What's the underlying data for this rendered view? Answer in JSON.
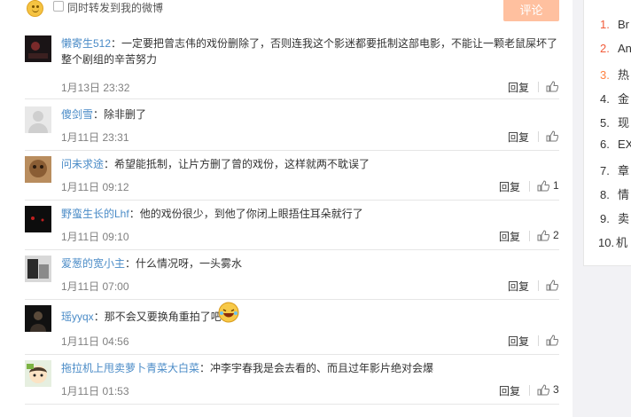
{
  "compose": {
    "repost_label": "同时转发到我的微博",
    "submit_label": "评论"
  },
  "comments": [
    {
      "user": "懒寄生512",
      "text": "一定要把曾志伟的戏份删除了，否则连我这个影迷都要抵制这部电影，不能让一颗老鼠屎坏了整个剧组的辛苦努力",
      "time": "1月13日 23:32",
      "reply": "回复",
      "likes": ""
    },
    {
      "user": "傻剑雪",
      "text": "除非删了",
      "time": "1月11日 23:31",
      "reply": "回复",
      "likes": ""
    },
    {
      "user": "问未求途",
      "text": "希望能抵制，让片方删了曾的戏份，这样就两不耽误了",
      "time": "1月11日 09:12",
      "reply": "回复",
      "likes": "1"
    },
    {
      "user": "野蛮生长的Lhf",
      "text": "他的戏份很少，到他了你闭上眼捂住耳朵就行了",
      "time": "1月11日 09:10",
      "reply": "回复",
      "likes": "2"
    },
    {
      "user": "爱葱的宽小主",
      "text": "什么情况呀，一头雾水",
      "time": "1月11日 07:00",
      "reply": "回复",
      "likes": ""
    },
    {
      "user": "瑶yyqx",
      "text": "那不会又要换角重拍了吧",
      "time": "1月11日 04:56",
      "reply": "回复",
      "likes": ""
    },
    {
      "user": "拖拉机上甩卖萝卜青菜大白菜",
      "text": "冲李宇春我是会去看的、而且过年影片绝对会爆",
      "time": "1月11日 01:53",
      "reply": "回复",
      "likes": "3"
    }
  ],
  "ranking": [
    {
      "num": "1.",
      "text": "Br"
    },
    {
      "num": "2.",
      "text": "An"
    },
    {
      "num": "3.",
      "text": "热"
    },
    {
      "num": "4.",
      "text": "金"
    },
    {
      "num": "5.",
      "text": "现"
    },
    {
      "num": "6.",
      "text": "EX"
    },
    {
      "num": "7.",
      "text": "章"
    },
    {
      "num": "8.",
      "text": "情"
    },
    {
      "num": "9.",
      "text": "卖"
    },
    {
      "num": "10.",
      "text": "机"
    }
  ],
  "colors": {
    "link": "#4a8bc7",
    "submit": "#ffc09f",
    "rank_top": "#f25b3a",
    "rank_hot": "#ff8140"
  }
}
